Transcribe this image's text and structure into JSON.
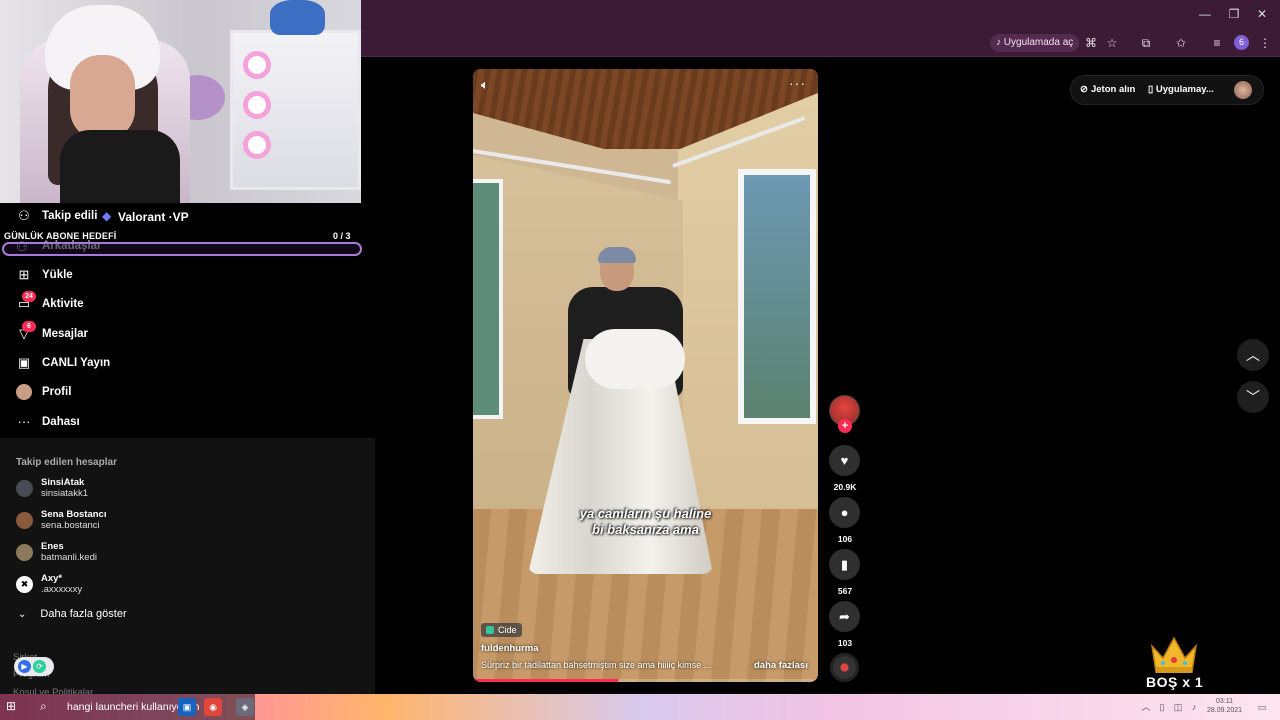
{
  "browser": {
    "open_in_app_label": "Uygulamada aç",
    "profile_badge": "6",
    "window_minimize": "—",
    "window_restore": "❐",
    "window_close": "✕"
  },
  "stream_overlay": {
    "goal_label": "GÜNLÜK ABONE HEDEFİ",
    "goal_count": "0 / 3",
    "goal_current": 0,
    "goal_total": 3,
    "game_label": "Valorant ·VP",
    "bos_label": "BOŞ x 1"
  },
  "sidebar": {
    "items": [
      {
        "label": "Takip edili",
        "icon": "person-follow-icon"
      },
      {
        "label": "Arkadaşlar",
        "icon": "friends-icon"
      },
      {
        "label": "Yükle",
        "icon": "upload-icon"
      },
      {
        "label": "Aktivite",
        "icon": "activity-icon",
        "badge": "24"
      },
      {
        "label": "Mesajlar",
        "icon": "messages-icon",
        "badge": "6"
      },
      {
        "label": "CANLI Yayın",
        "icon": "live-icon"
      },
      {
        "label": "Profil",
        "icon": "profile-avatar"
      },
      {
        "label": "Dahası",
        "icon": "more-icon"
      }
    ],
    "following_title": "Takip edilen hesaplar",
    "accounts": [
      {
        "name": "SinsiAtak",
        "handle": "sinsiatakk1"
      },
      {
        "name": "Sena Bostancı",
        "handle": "sena.bostanci"
      },
      {
        "name": "Enes",
        "handle": "batmanli.kedi"
      },
      {
        "name": "Axy*",
        "handle": ".axxxxxxy"
      }
    ],
    "show_more": "Daha fazla göster",
    "footer": [
      "Şirket",
      "Program",
      "Koşul ve Politikalar"
    ]
  },
  "video": {
    "subtitle_line1": "ya camların şu haline",
    "subtitle_line2": "bi baksanıza ama",
    "location": "Cide",
    "author": "fuldenhurma",
    "description": "Sürpriz bir tadilattan bahsetmiştim size ama hiiiiç kimse ...",
    "more_label": "daha fazlası",
    "progress": 0.42
  },
  "actions": {
    "likes": "20.9K",
    "comments": "106",
    "saves": "567",
    "shares": "103"
  },
  "topright": {
    "coins_label": "Jeton alın",
    "app_label": "Uygulamay..."
  },
  "taskbar": {
    "search_text": "hangi launcheri kullanıyosun",
    "time": "03:11",
    "date": "28.09.2021"
  }
}
